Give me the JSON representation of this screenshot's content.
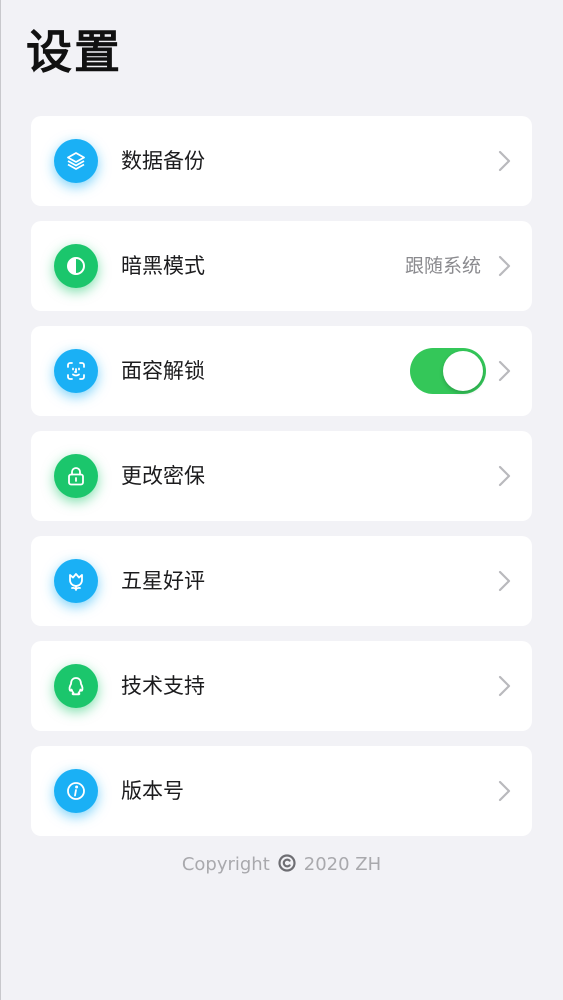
{
  "header": {
    "title": "设置"
  },
  "settings": {
    "items": [
      {
        "id": "backup",
        "label": "数据备份",
        "icon": "layers-icon",
        "color": "#1ab0f5"
      },
      {
        "id": "dark-mode",
        "label": "暗黑模式",
        "value": "跟随系统",
        "icon": "contrast-icon",
        "color": "#1bc66c"
      },
      {
        "id": "face-unlock",
        "label": "面容解锁",
        "icon": "face-id-icon",
        "color": "#1ab0f5",
        "toggle_on": true
      },
      {
        "id": "change-security",
        "label": "更改密保",
        "icon": "lock-icon",
        "color": "#1bc66c"
      },
      {
        "id": "rate",
        "label": "五星好评",
        "icon": "flower-icon",
        "color": "#1ab0f5"
      },
      {
        "id": "support",
        "label": "技术支持",
        "icon": "qq-penguin-icon",
        "color": "#1bc66c"
      },
      {
        "id": "version",
        "label": "版本号",
        "icon": "info-icon",
        "color": "#1ab0f5"
      }
    ]
  },
  "footer": {
    "copyright_label": "Copyright",
    "copyright_year_owner": "2020 ZH"
  },
  "colors": {
    "background": "#f2f2f6",
    "toggle_on": "#34c759",
    "accent_blue": "#1ab0f5",
    "accent_green": "#1bc66c"
  }
}
